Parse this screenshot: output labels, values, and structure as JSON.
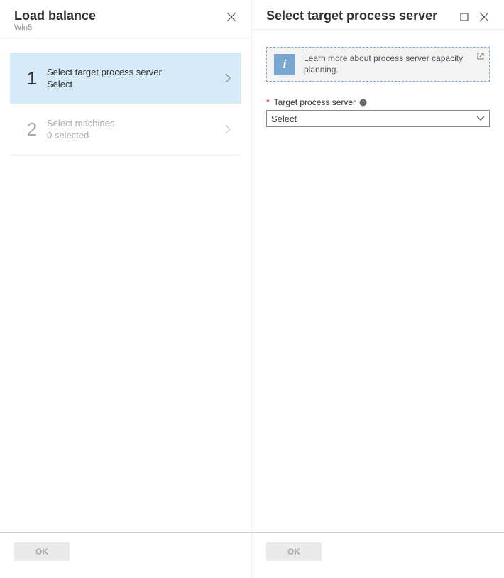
{
  "left": {
    "title": "Load balance",
    "subtitle": "Win5",
    "steps": [
      {
        "num": "1",
        "title": "Select target process server",
        "sub": "Select",
        "active": true
      },
      {
        "num": "2",
        "title": "Select machines",
        "sub": "0 selected",
        "active": false
      }
    ],
    "ok_label": "OK"
  },
  "right": {
    "title": "Select target process server",
    "info_text": "Learn more about process server capacity planning.",
    "field_label": "Target process server",
    "select_value": "Select",
    "ok_label": "OK"
  }
}
